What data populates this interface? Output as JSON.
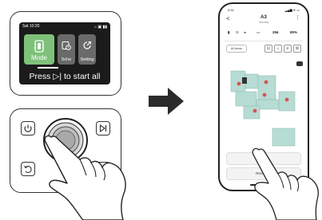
{
  "device_screen": {
    "time": "Sat 10:20",
    "status_icons": "⌂ ▣ ▮▮",
    "tiles": [
      {
        "label": "Mode",
        "icon": "mode-icon"
      },
      {
        "label": "Sche",
        "icon": "schedule-icon"
      },
      {
        "label": "Setting",
        "icon": "setting-icon"
      }
    ],
    "prompt": "Press ▷| to start all"
  },
  "device_buttons": {
    "power_icon": "power-icon",
    "start_icon": "play-pause-icon",
    "back_icon": "back-icon",
    "dial_icon": "dial-icon"
  },
  "phone": {
    "time": "9:41",
    "status_right": "▂▄▆ ≋ ▭",
    "title": "A3",
    "subtitle": "Standby",
    "back": "<",
    "more": "⋮",
    "battery": "80%",
    "area": "256",
    "chip_label": "All Areas",
    "start_label": "Start",
    "recharge_label": "Recharge"
  },
  "colors": {
    "tile_active": "#7ec17a",
    "tile_inactive": "#6a6a6a",
    "screen_bg": "#1b1b1b",
    "arrow": "#2b2b2b",
    "map_zone": "#b7dcd3",
    "marker_red": "#d9534f"
  }
}
